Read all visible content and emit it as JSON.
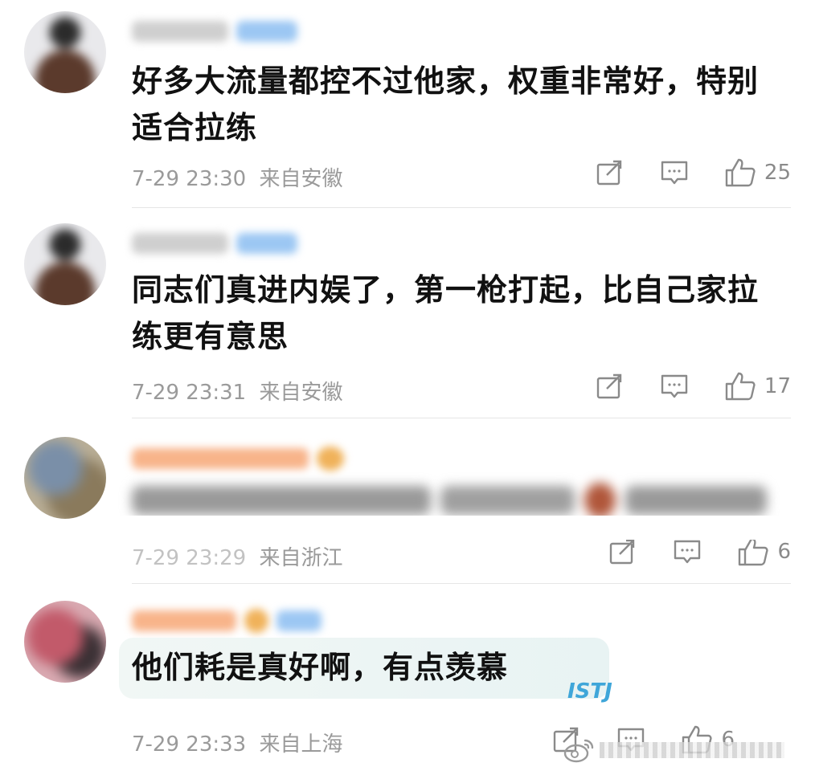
{
  "comments": [
    {
      "text": "好多大流量都控不过他家，权重非常好，特别适合拉练",
      "time": "7-29 23:30",
      "location": "来自安徽",
      "likes": "25"
    },
    {
      "text": "同志们真进内娱了，第一枪打起，比自己家拉练更有意思",
      "time": "7-29 23:31",
      "location": "来自安徽",
      "likes": "17"
    },
    {
      "text": "",
      "time": "7-29 23:29",
      "location": "来自浙江",
      "likes": "6"
    },
    {
      "text": "他们耗是真好啊，有点羡慕",
      "time": "7-29 23:33",
      "location": "来自上海",
      "likes": "6"
    }
  ],
  "bubble_badge": "ISTJ",
  "icons": {
    "share": "share-icon",
    "reply": "comment-icon",
    "like": "thumbs-up-icon"
  },
  "colors": {
    "vip_blue": "#8fc0f0",
    "orange_name": "#f6a36b",
    "meta_gray": "#9a9a9a"
  }
}
